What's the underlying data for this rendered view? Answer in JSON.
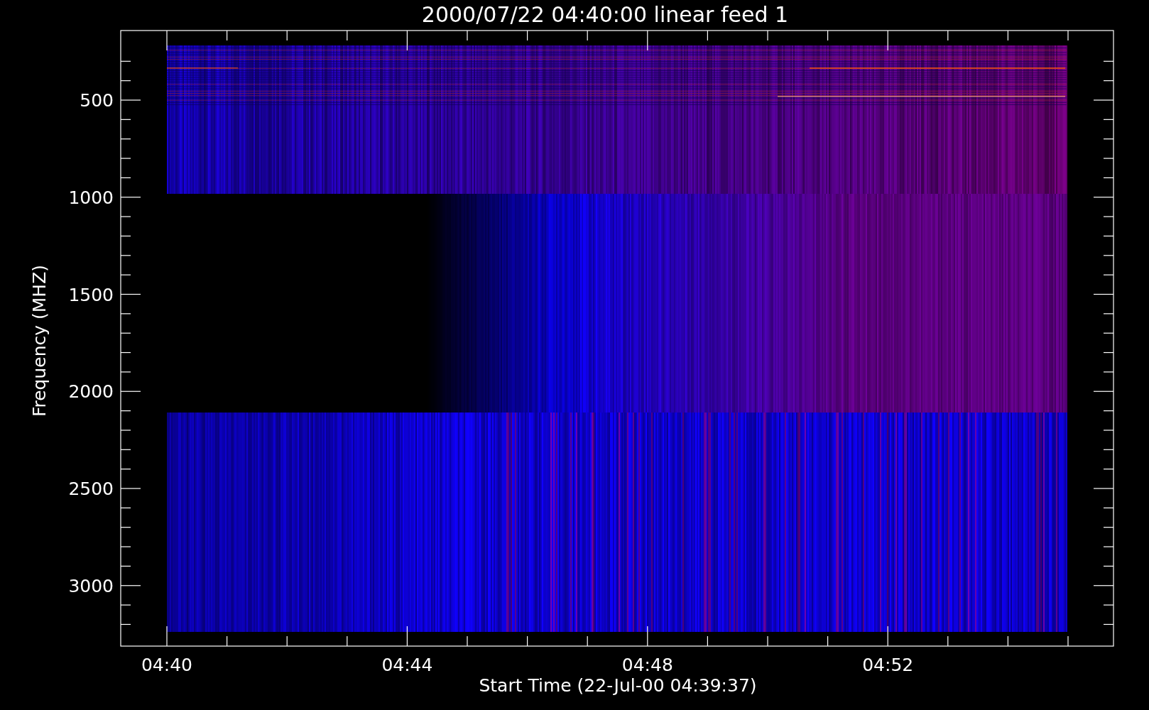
{
  "title": "2000/07/22 04:40:00 linear feed 1",
  "xlabel": "Start Time (22-Jul-00 04:39:37)",
  "ylabel": "Frequency (MHZ)",
  "xticks": [
    "04:40",
    "04:44",
    "04:48",
    "04:52"
  ],
  "yticks": [
    "500",
    "1000",
    "1500",
    "2000",
    "2500",
    "3000"
  ]
}
